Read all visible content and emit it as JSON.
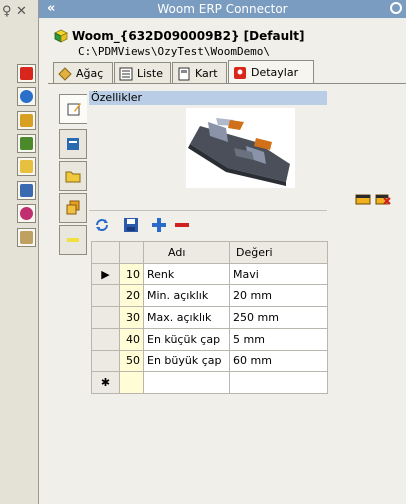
{
  "window": {
    "title": "Woom ERP Connector",
    "collapse_glyph": "«"
  },
  "left_strip": {
    "top_glyphs": [
      "♀",
      "✕"
    ],
    "buttons": [
      {
        "name": "woom-red-icon",
        "color": "#d9261c"
      },
      {
        "name": "refresh-globe-icon",
        "color": "#2a6fc9"
      },
      {
        "name": "home-icon",
        "color": "#d8a020"
      },
      {
        "name": "report-icon",
        "color": "#4a8a2a"
      },
      {
        "name": "folder-icon",
        "color": "#e8c040"
      },
      {
        "name": "list-icon",
        "color": "#3a6ab0"
      },
      {
        "name": "color-ball-icon",
        "color": "#c03070"
      },
      {
        "name": "notes-icon",
        "color": "#c0a060"
      }
    ]
  },
  "header": {
    "doc_title": "Woom_{632D090009B2} [Default]",
    "doc_path": "C:\\PDMViews\\OzyTest\\WoomDemo\\"
  },
  "tabs": [
    {
      "label": "Ağaç",
      "icon": "tree-icon"
    },
    {
      "label": "Liste",
      "icon": "list-icon"
    },
    {
      "label": "Kart",
      "icon": "card-icon"
    },
    {
      "label": "Detaylar",
      "icon": "woom-red-icon",
      "active": true
    }
  ],
  "side_tabs": [
    "edit-icon",
    "form-icon",
    "folder-icon",
    "stack-icon",
    "minus-yellow-icon"
  ],
  "properties": {
    "section_title": "Özellikler",
    "grid": {
      "columns": [
        "Adı",
        "Değeri"
      ],
      "rows": [
        {
          "id": "10",
          "name": "Renk",
          "value": "Mavi",
          "current": true
        },
        {
          "id": "20",
          "name": "Min. açıklık",
          "value": "20 mm"
        },
        {
          "id": "30",
          "name": "Max. açıklık",
          "value": "250 mm"
        },
        {
          "id": "40",
          "name": "En küçük çap",
          "value": "5 mm"
        },
        {
          "id": "50",
          "name": "En büyük çap",
          "value": "60 mm"
        }
      ],
      "new_row_marker": "✱"
    }
  },
  "colors": {
    "titlebar": "#7a9cc0",
    "section": "#b9cee6",
    "idcell": "#fffcd6"
  }
}
